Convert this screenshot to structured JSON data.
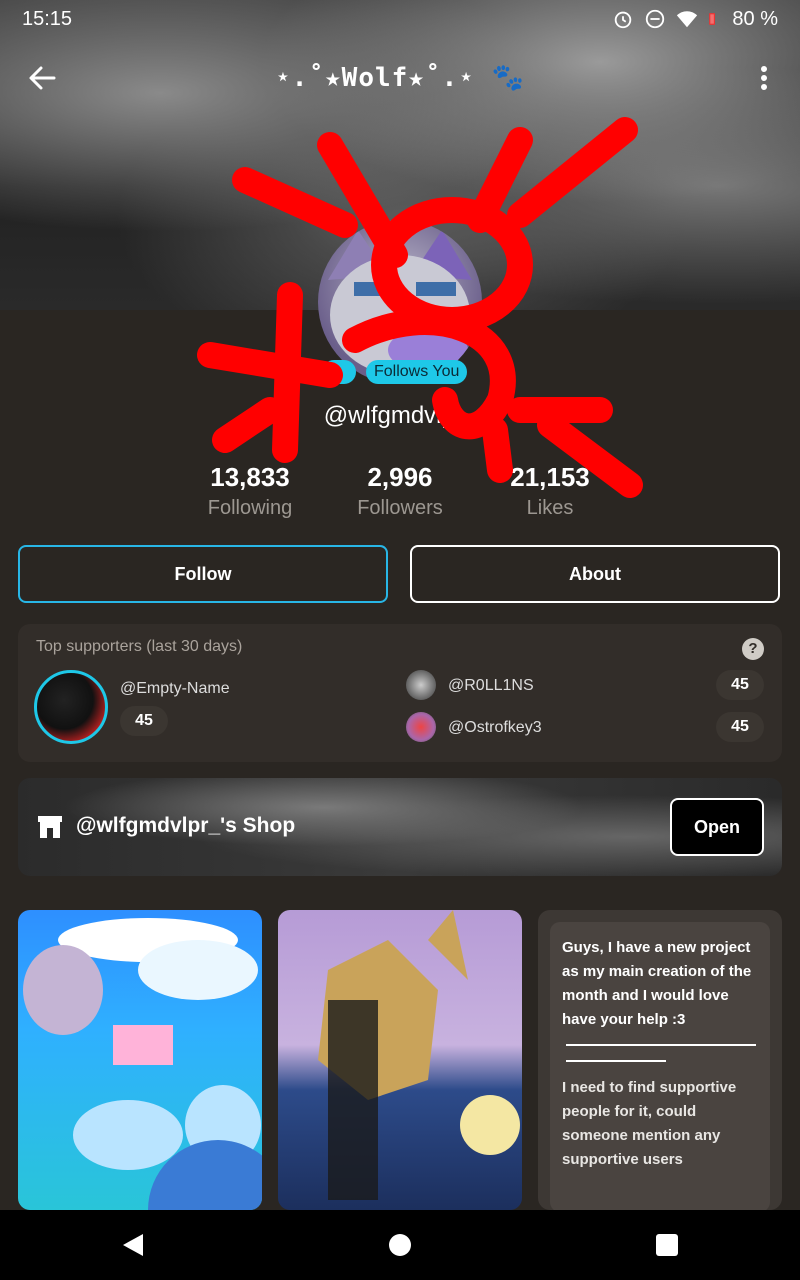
{
  "status": {
    "time": "15:15",
    "battery": "80 %"
  },
  "header": {
    "title": "⋆.˚★Wolf★˚.⋆ 🐾"
  },
  "profile": {
    "badges": [
      "Friend",
      "Follows You"
    ],
    "handle": "@wlfgmdvlpr_",
    "stats": [
      {
        "value": "13,833",
        "label": "Following"
      },
      {
        "value": "2,996",
        "label": "Followers"
      },
      {
        "value": "21,153",
        "label": "Likes"
      }
    ]
  },
  "actions": {
    "follow": "Follow",
    "about": "About"
  },
  "supporters": {
    "title": "Top supporters (last 30 days)",
    "help": "?",
    "top": {
      "name": "@Empty-Name",
      "count": "45"
    },
    "others": [
      {
        "name": "@R0LL1NS",
        "count": "45"
      },
      {
        "name": "@Ostrofkey3",
        "count": "45"
      }
    ]
  },
  "shop": {
    "label": "@wlfgmdvlpr_'s Shop",
    "open": "Open"
  },
  "posts": {
    "card3_text1": "Guys, I have a new project as my main creation of the month and I would love have your help :3",
    "card3_text2": "I need to find supportive people for it, could someone mention any supportive users"
  },
  "colors": {
    "accent": "#1ec8e8",
    "scribble": "#ff0000",
    "bg": "#2a2622"
  }
}
